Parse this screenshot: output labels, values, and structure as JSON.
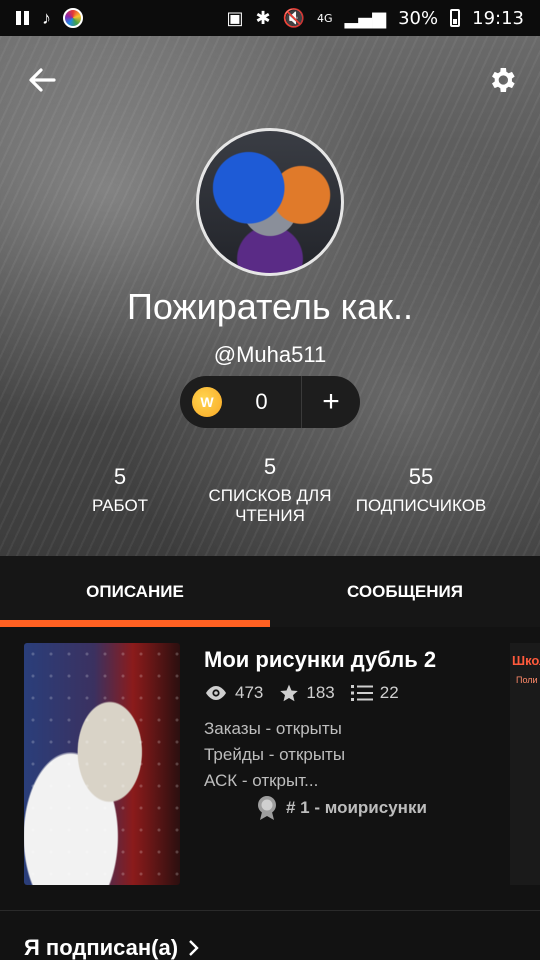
{
  "status_bar": {
    "signal_label": "4G",
    "battery": "30%",
    "time": "19:13"
  },
  "profile": {
    "name": "Пожиратель как..",
    "handle": "@Muha511"
  },
  "coins": {
    "count": "0",
    "coin_letter": "W",
    "add_label": "+"
  },
  "stats": {
    "works": {
      "value": "5",
      "label": "РАБОТ"
    },
    "reading_lists": {
      "value": "5",
      "label": "СПИСКОВ ДЛЯ ЧТЕНИЯ"
    },
    "followers": {
      "value": "55",
      "label": "ПОДПИСЧИКОВ"
    }
  },
  "tabs": [
    {
      "label": "ОПИСАНИЕ",
      "active": true
    },
    {
      "label": "СООБЩЕНИЯ",
      "active": false
    }
  ],
  "story": {
    "title": "Мои рисунки дубль 2",
    "views": "473",
    "votes": "183",
    "parts": "22",
    "description": [
      "Заказы - открыты",
      "Трейды - открыты",
      "АСК - открыт..."
    ],
    "rank": "# 1 - моирисунки"
  },
  "next_story": {
    "title": "Школ",
    "subtitle": "Поли"
  },
  "following": {
    "label": "Я подписан(а)"
  },
  "colors": {
    "accent": "#ff6122",
    "background": "#121212",
    "tab_bar": "#161616",
    "coin": "#f9a825"
  }
}
